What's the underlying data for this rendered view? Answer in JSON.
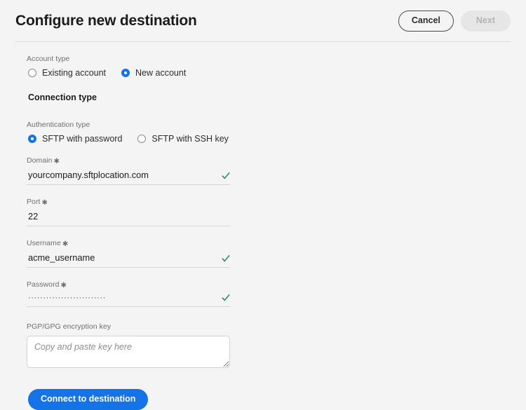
{
  "header": {
    "title": "Configure new destination",
    "cancel_label": "Cancel",
    "next_label": "Next"
  },
  "account_type": {
    "label": "Account type",
    "options": [
      {
        "label": "Existing account",
        "selected": false
      },
      {
        "label": "New account",
        "selected": true
      }
    ]
  },
  "connection_type": {
    "heading": "Connection type"
  },
  "authentication_type": {
    "label": "Authentication type",
    "options": [
      {
        "label": "SFTP with password",
        "selected": true
      },
      {
        "label": "SFTP with SSH key",
        "selected": false
      }
    ]
  },
  "fields": {
    "domain": {
      "label": "Domain",
      "required_mark": "✱",
      "value": "yourcompany.sftplocation.com",
      "valid": true
    },
    "port": {
      "label": "Port",
      "required_mark": "✱",
      "value": "22",
      "valid": false
    },
    "username": {
      "label": "Username",
      "required_mark": "✱",
      "value": "acme_username",
      "valid": true
    },
    "password": {
      "label": "Password",
      "required_mark": "✱",
      "value": "··························",
      "valid": true
    },
    "pgp_key": {
      "label": "PGP/GPG encryption key",
      "value": "",
      "placeholder": "Copy and paste key here"
    }
  },
  "actions": {
    "connect_label": "Connect to destination"
  },
  "colors": {
    "accent_blue": "#1473e6",
    "valid_green": "#268e6c",
    "page_background": "#f4f4f4",
    "disabled_gray": "#e6e6e6"
  }
}
